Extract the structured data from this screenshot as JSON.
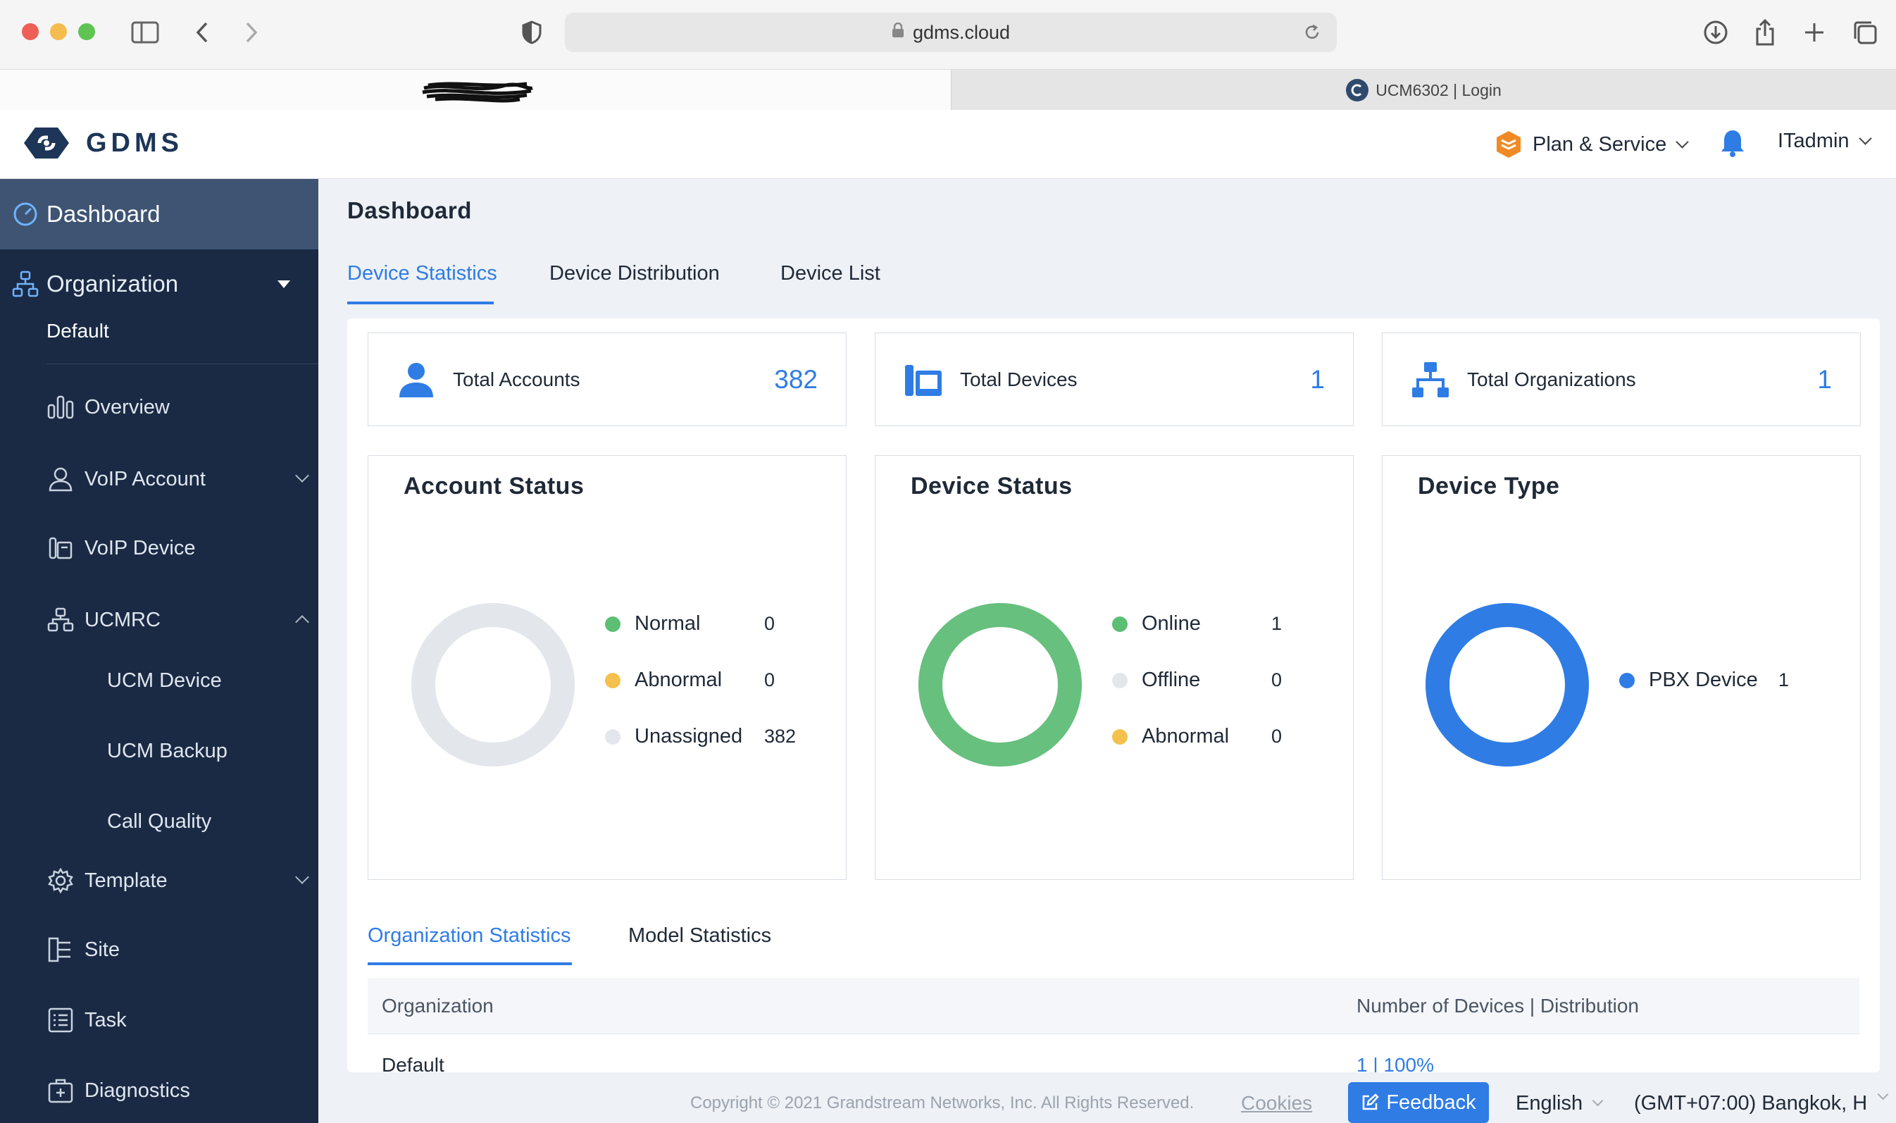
{
  "browser": {
    "url": "gdms.cloud",
    "tab_title": "UCM6302 | Login"
  },
  "header": {
    "logo_text": "GDMS",
    "plan_service": "Plan & Service",
    "user": "ITadmin"
  },
  "sidebar": {
    "dashboard": "Dashboard",
    "organization": "Organization",
    "org_selected": "Default",
    "items": [
      {
        "label": "Overview"
      },
      {
        "label": "VoIP Account"
      },
      {
        "label": "VoIP Device"
      },
      {
        "label": "UCMRC"
      },
      {
        "label": "UCM Device"
      },
      {
        "label": "UCM Backup"
      },
      {
        "label": "Call Quality"
      },
      {
        "label": "Template"
      },
      {
        "label": "Site"
      },
      {
        "label": "Task"
      },
      {
        "label": "Diagnostics"
      }
    ]
  },
  "main": {
    "title": "Dashboard",
    "tabs": [
      {
        "label": "Device Statistics",
        "active": true
      },
      {
        "label": "Device Distribution",
        "active": false
      },
      {
        "label": "Device List",
        "active": false
      }
    ],
    "stats": [
      {
        "label": "Total Accounts",
        "value": "382"
      },
      {
        "label": "Total Devices",
        "value": "1"
      },
      {
        "label": "Total Organizations",
        "value": "1"
      }
    ],
    "account_status": {
      "title": "Account Status",
      "legend": [
        {
          "label": "Normal",
          "value": "0",
          "color": "#5cbf74"
        },
        {
          "label": "Abnormal",
          "value": "0",
          "color": "#f3c14c"
        },
        {
          "label": "Unassigned",
          "value": "382",
          "color": "#e3e7ec"
        }
      ]
    },
    "device_status": {
      "title": "Device Status",
      "legend": [
        {
          "label": "Online",
          "value": "1",
          "color": "#5cbf74"
        },
        {
          "label": "Offline",
          "value": "0",
          "color": "#e3e7ec"
        },
        {
          "label": "Abnormal",
          "value": "0",
          "color": "#f3c14c"
        }
      ]
    },
    "device_type": {
      "title": "Device Type",
      "legend": [
        {
          "label": "PBX Device",
          "value": "1",
          "color": "#2f7ce5"
        }
      ]
    },
    "bottom_tabs": [
      {
        "label": "Organization Statistics",
        "active": true
      },
      {
        "label": "Model Statistics",
        "active": false
      }
    ],
    "table": {
      "headers": [
        "Organization",
        "Number of Devices | Distribution"
      ],
      "rows": [
        {
          "organization": "Default",
          "distribution": "1 | 100%"
        }
      ]
    }
  },
  "footer": {
    "copyright": "Copyright © 2021 Grandstream Networks, Inc. All Rights Reserved.",
    "cookies": "Cookies",
    "feedback": "Feedback",
    "language": "English",
    "timezone": "(GMT+07:00) Bangkok, H"
  },
  "colors": {
    "accent": "#2f7ce5",
    "sidebar_bg": "#1a2a44",
    "sidebar_active": "#3f5473",
    "online_green": "#5cbf74",
    "abnormal_yellow": "#f3c14c",
    "empty_grey": "#e3e7ec"
  }
}
